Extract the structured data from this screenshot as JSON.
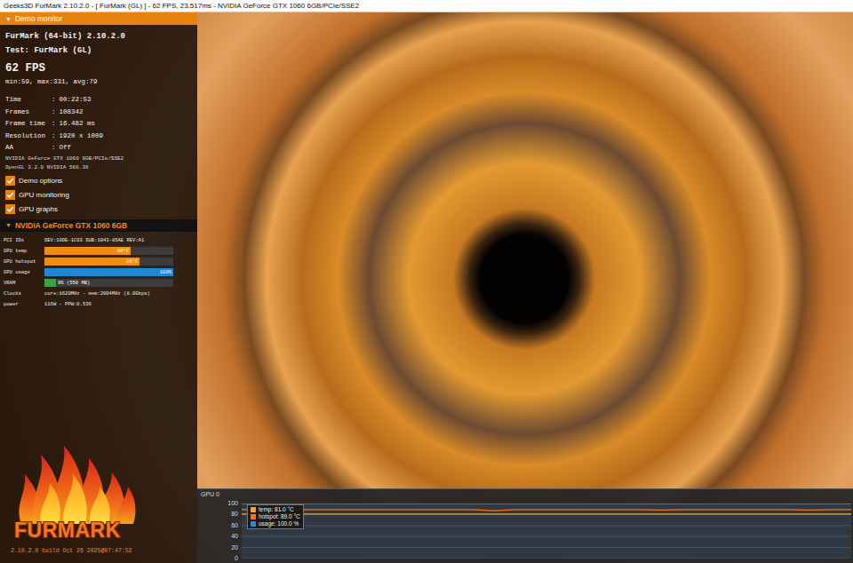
{
  "window": {
    "title": "Geeks3D FurMark 2.10.2.0 - [ FurMark (GL) ] - 62 FPS, 23.517ms - NVIDIA GeForce GTX 1060 6GB/PCIe/SSE2"
  },
  "demo_monitor": {
    "header_icon": "▼",
    "title": "Demo monitor",
    "expanded": true,
    "app": "FurMark (64-bit) 2.10.2.0",
    "test": "Test: FurMark (GL)",
    "fps": "62 FPS",
    "fps_stats": "min:59, max:331, avg:79",
    "separator": ":",
    "stats": [
      {
        "label": "Time",
        "value": "00:22:53"
      },
      {
        "label": "Frames",
        "value": "108342"
      },
      {
        "label": "Frame time",
        "value": "16.482 ms"
      },
      {
        "label": "Resolution",
        "value": "1920 x 1009"
      },
      {
        "label": "AA",
        "value": "Off"
      }
    ],
    "renderer": "NVIDIA GeForce GTX 1060 6GB/PCIe/SSE2",
    "opengl": "OpenGL 3.2.0 NVIDIA 566.36",
    "options": [
      {
        "label": "Demo options",
        "checked": true
      },
      {
        "label": "GPU monitoring",
        "checked": true
      },
      {
        "label": "GPU graphs",
        "checked": true
      }
    ]
  },
  "gpu_panel": {
    "header_icon": "▼",
    "title": "NVIDIA GeForce GTX 1060 6GB",
    "expanded": true,
    "rows": [
      {
        "kind": "text",
        "label": "PCI IDs",
        "value": "DEV:10DE-1C03 SUB:1043-85AE REV:A1"
      },
      {
        "kind": "bar",
        "label": "GPU temp",
        "level": 0.67,
        "reading": "80°C",
        "color": "#f08c10"
      },
      {
        "kind": "bar",
        "label": "GPU hotspot",
        "level": 0.74,
        "reading": "89°C",
        "color": "#f08c10"
      },
      {
        "kind": "bar",
        "label": "GPU usage",
        "level": 1.0,
        "reading": "100%",
        "color": "#1e88d4"
      },
      {
        "kind": "bar",
        "label": "VRAM",
        "level": 0.09,
        "reading": "9% (550 MB)",
        "color": "#3ea04a"
      },
      {
        "kind": "text",
        "label": "Clocks",
        "value": "core:1620MHz - mem:2004MHz (8.0Gbps)"
      },
      {
        "kind": "text",
        "label": "power",
        "value": "116W - PPW:0.536"
      }
    ]
  },
  "logo": {
    "text": "FURMARK"
  },
  "build": "2.10.2.0 build Oct 26 2025@07:47:52",
  "graph": {
    "title": "GPU 0",
    "y_ticks": [
      "100",
      "80",
      "60",
      "40",
      "20",
      "0"
    ],
    "series": [
      {
        "name": "temp",
        "legend": "temp: 81.0 °C",
        "color": "#f0a030",
        "values": [
          81,
          81,
          81,
          81,
          81,
          81,
          81,
          81,
          81,
          81,
          81,
          81,
          81,
          81,
          81,
          81,
          81,
          81,
          81,
          81,
          81,
          81,
          81,
          81,
          81,
          81,
          81,
          81,
          81,
          81
        ]
      },
      {
        "name": "hotspot",
        "legend": "hotspot: 89.0 °C",
        "color": "#f07818",
        "values": [
          89,
          89,
          88,
          89,
          89,
          89,
          89,
          89,
          89,
          89,
          89,
          89,
          87,
          89,
          89,
          89,
          89,
          89,
          89,
          89,
          88,
          89,
          89,
          89,
          89,
          89,
          89,
          88,
          89,
          89
        ]
      },
      {
        "name": "usage",
        "legend": "usage: 100.0 %",
        "color": "#2a8ad8",
        "values": [
          100,
          100,
          100,
          100,
          100,
          100,
          100,
          100,
          100,
          100,
          100,
          100,
          100,
          100,
          100,
          100,
          100,
          100,
          100,
          100,
          100,
          100,
          100,
          100,
          100,
          100,
          100,
          100,
          100,
          100
        ]
      }
    ]
  }
}
